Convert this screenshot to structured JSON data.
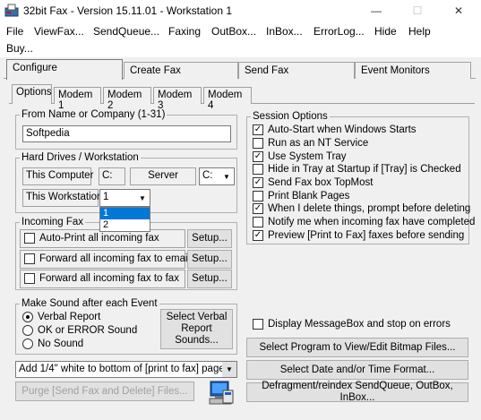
{
  "window": {
    "title": "32bit Fax - Version 15.11.01 - Workstation 1",
    "min_glyph": "—",
    "max_glyph": "☐",
    "close_glyph": "✕"
  },
  "menu": [
    "File",
    "ViewFax...",
    "SendQueue...",
    "Faxing",
    "OutBox...",
    "InBox...",
    "ErrorLog...",
    "Hide",
    "Help",
    "Buy..."
  ],
  "tabs": [
    "Configure",
    "Create Fax",
    "Send Fax",
    "Event Monitors"
  ],
  "subtabs": [
    "Options",
    "Modem 1",
    "Modem 2",
    "Modem 3",
    "Modem 4"
  ],
  "from_group": {
    "title": "From Name or Company (1-31)",
    "value": "Softpedia"
  },
  "hard_drives": {
    "title": "Hard Drives / Workstation",
    "this_computer_label": "This Computer",
    "this_computer_drive": "C:",
    "server_label": "Server",
    "server_drive": "C:",
    "this_workstation_label": "This Workstation",
    "workstation_value": "1",
    "workstation_options": [
      "1",
      "2"
    ]
  },
  "incoming": {
    "title": "Incoming Fax",
    "rows": [
      {
        "label": "Auto-Print all incoming fax",
        "button": "Setup..."
      },
      {
        "label": "Forward all incoming fax to email",
        "button": "Setup..."
      },
      {
        "label": "Forward all incoming fax to fax",
        "button": "Setup..."
      }
    ]
  },
  "sound": {
    "title": "Make Sound after each Event",
    "options": [
      "Verbal Report",
      "OK or ERROR Sound",
      "No Sound"
    ],
    "selected": 0,
    "button": "Select Verbal Report Sounds..."
  },
  "white_select": "Add 1/4\" white to bottom of [print to fax] pages",
  "purge_button": "Purge [Send Fax and Delete] Files...",
  "session": {
    "title": "Session Options",
    "items": [
      {
        "label": "Auto-Start when Windows Starts",
        "checked": true
      },
      {
        "label": "Run as an NT Service",
        "checked": false
      },
      {
        "label": "Use System Tray",
        "checked": true
      },
      {
        "label": "Hide in Tray at Startup if [Tray] is Checked",
        "checked": false
      },
      {
        "label": "Send Fax box TopMost",
        "checked": true
      },
      {
        "label": "Print Blank Pages",
        "checked": false
      },
      {
        "label": "When I delete things, prompt before deleting",
        "checked": true
      },
      {
        "label": "Notify me when incoming fax have completed",
        "checked": false
      },
      {
        "label": "Preview [Print to Fax] faxes before sending",
        "checked": true
      }
    ]
  },
  "msgbox_check": {
    "label": "Display MessageBox and stop on errors",
    "checked": false
  },
  "right_buttons": [
    "Select Program to View/Edit Bitmap Files...",
    "Select Date and/or Time Format...",
    "Defragment/reindex SendQueue, OutBox, InBox..."
  ],
  "colors": {
    "selection": "#0078d7",
    "window_bg": "#f0f0f0"
  }
}
